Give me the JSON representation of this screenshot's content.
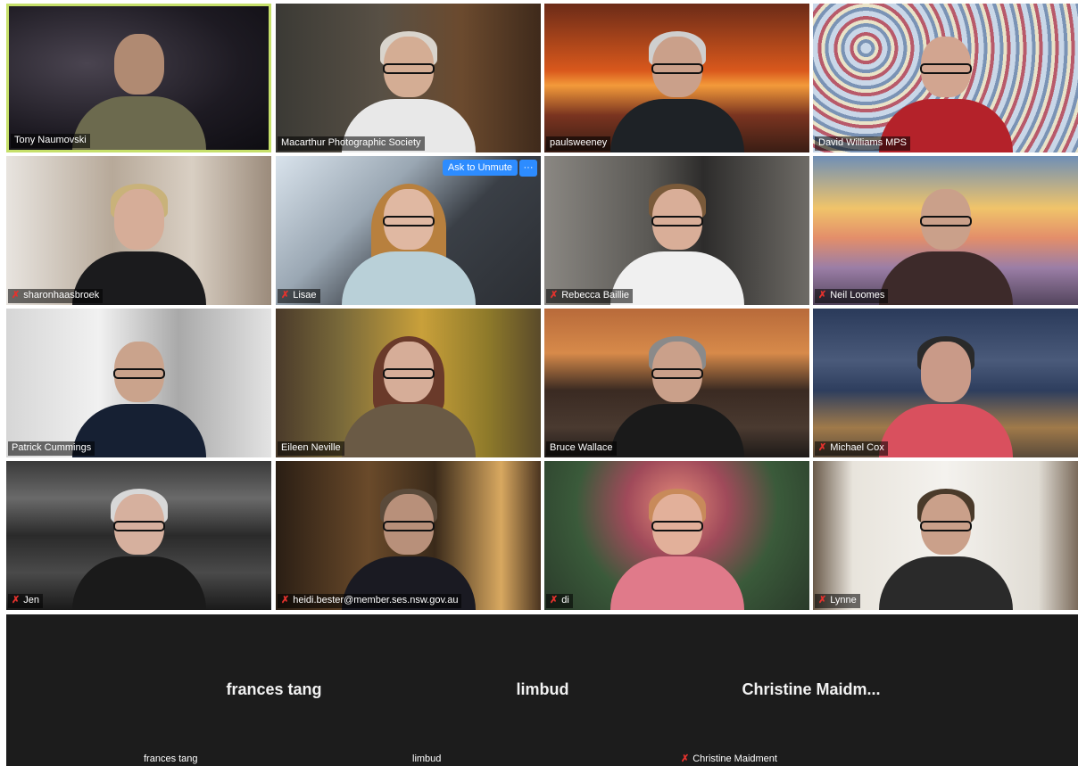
{
  "participants": [
    {
      "name": "Tony Naumovski",
      "muted": false,
      "active": true
    },
    {
      "name": "Macarthur Photographic Society",
      "muted": false
    },
    {
      "name": "paulsweeney",
      "muted": false
    },
    {
      "name": "David Williams MPS",
      "muted": false
    },
    {
      "name": "sharonhaasbroek",
      "muted": true
    },
    {
      "name": "Lisae",
      "muted": true,
      "unmute_label": "Ask to Unmute",
      "more_label": "···"
    },
    {
      "name": "Rebecca Baillie",
      "muted": true
    },
    {
      "name": "Neil Loomes",
      "muted": true
    },
    {
      "name": "Patrick Cummings",
      "muted": false
    },
    {
      "name": "Eileen Neville",
      "muted": false
    },
    {
      "name": "Bruce Wallace",
      "muted": false
    },
    {
      "name": "Michael Cox",
      "muted": true
    },
    {
      "name": "Jen",
      "muted": true
    },
    {
      "name": "heidi.bester@member.ses.nsw.gov.au",
      "muted": true
    },
    {
      "name": "di",
      "muted": true
    },
    {
      "name": "Lynne",
      "muted": true
    }
  ],
  "video_off": [
    {
      "display": "frances tang",
      "label": "frances tang",
      "muted": false
    },
    {
      "display": "limbud",
      "label": "limbud",
      "muted": false
    },
    {
      "display": "Christine  Maidm...",
      "label": "Christine Maidment",
      "muted": true
    }
  ],
  "colors": {
    "active_border": "#c6e06a",
    "muted_icon": "#e5322d",
    "button": "#2d8cff"
  }
}
